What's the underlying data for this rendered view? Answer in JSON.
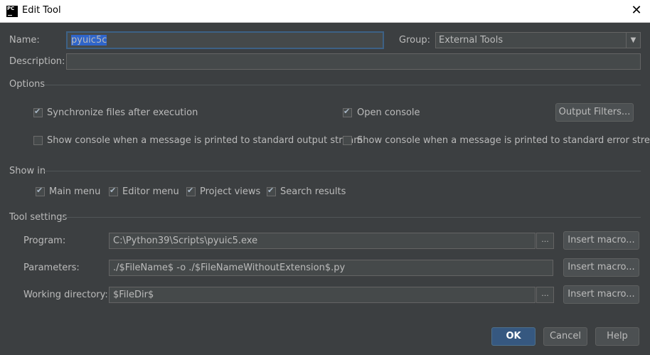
{
  "window": {
    "app_icon_text": "PC",
    "title": "Edit Tool",
    "close_glyph": "✕"
  },
  "form": {
    "name_label": "Name:",
    "name_value": "pyuic5c",
    "group_label": "Group:",
    "group_value": "External Tools",
    "description_label": "Description:",
    "description_value": ""
  },
  "options": {
    "section_label": "Options",
    "sync_files": {
      "label": "Synchronize files after execution",
      "checked": true
    },
    "open_console": {
      "label": "Open console",
      "checked": true
    },
    "output_filters_label": "Output Filters...",
    "show_console_stdout": {
      "label": "Show console when a message is printed to standard output stream",
      "checked": false
    },
    "show_console_stderr": {
      "label": "Show console when a message is printed to standard error stream",
      "checked": false
    }
  },
  "show_in": {
    "section_label": "Show in",
    "main_menu": {
      "label": "Main menu",
      "checked": true
    },
    "editor_menu": {
      "label": "Editor menu",
      "checked": true
    },
    "project_views": {
      "label": "Project views",
      "checked": true
    },
    "search_results": {
      "label": "Search results",
      "checked": true
    }
  },
  "tool_settings": {
    "section_label": "Tool settings",
    "program_label": "Program:",
    "program_value": "C:\\Python39\\Scripts\\pyuic5.exe",
    "parameters_label": "Parameters:",
    "parameters_value": "./$FileName$ -o ./$FileNameWithoutExtension$.py",
    "working_dir_label": "Working directory:",
    "working_dir_value": "$FileDir$",
    "ellipsis_label": "...",
    "insert_macro_label": "Insert macro..."
  },
  "footer": {
    "ok_label": "OK",
    "cancel_label": "Cancel",
    "help_label": "Help"
  },
  "icons": {
    "app": "pycharm-icon",
    "close": "close-icon",
    "dropdown": "chevron-down-icon"
  },
  "colors": {
    "background": "#3c3f41",
    "field": "#45494a",
    "primary_button": "#365880",
    "selection": "#2f65ca"
  }
}
